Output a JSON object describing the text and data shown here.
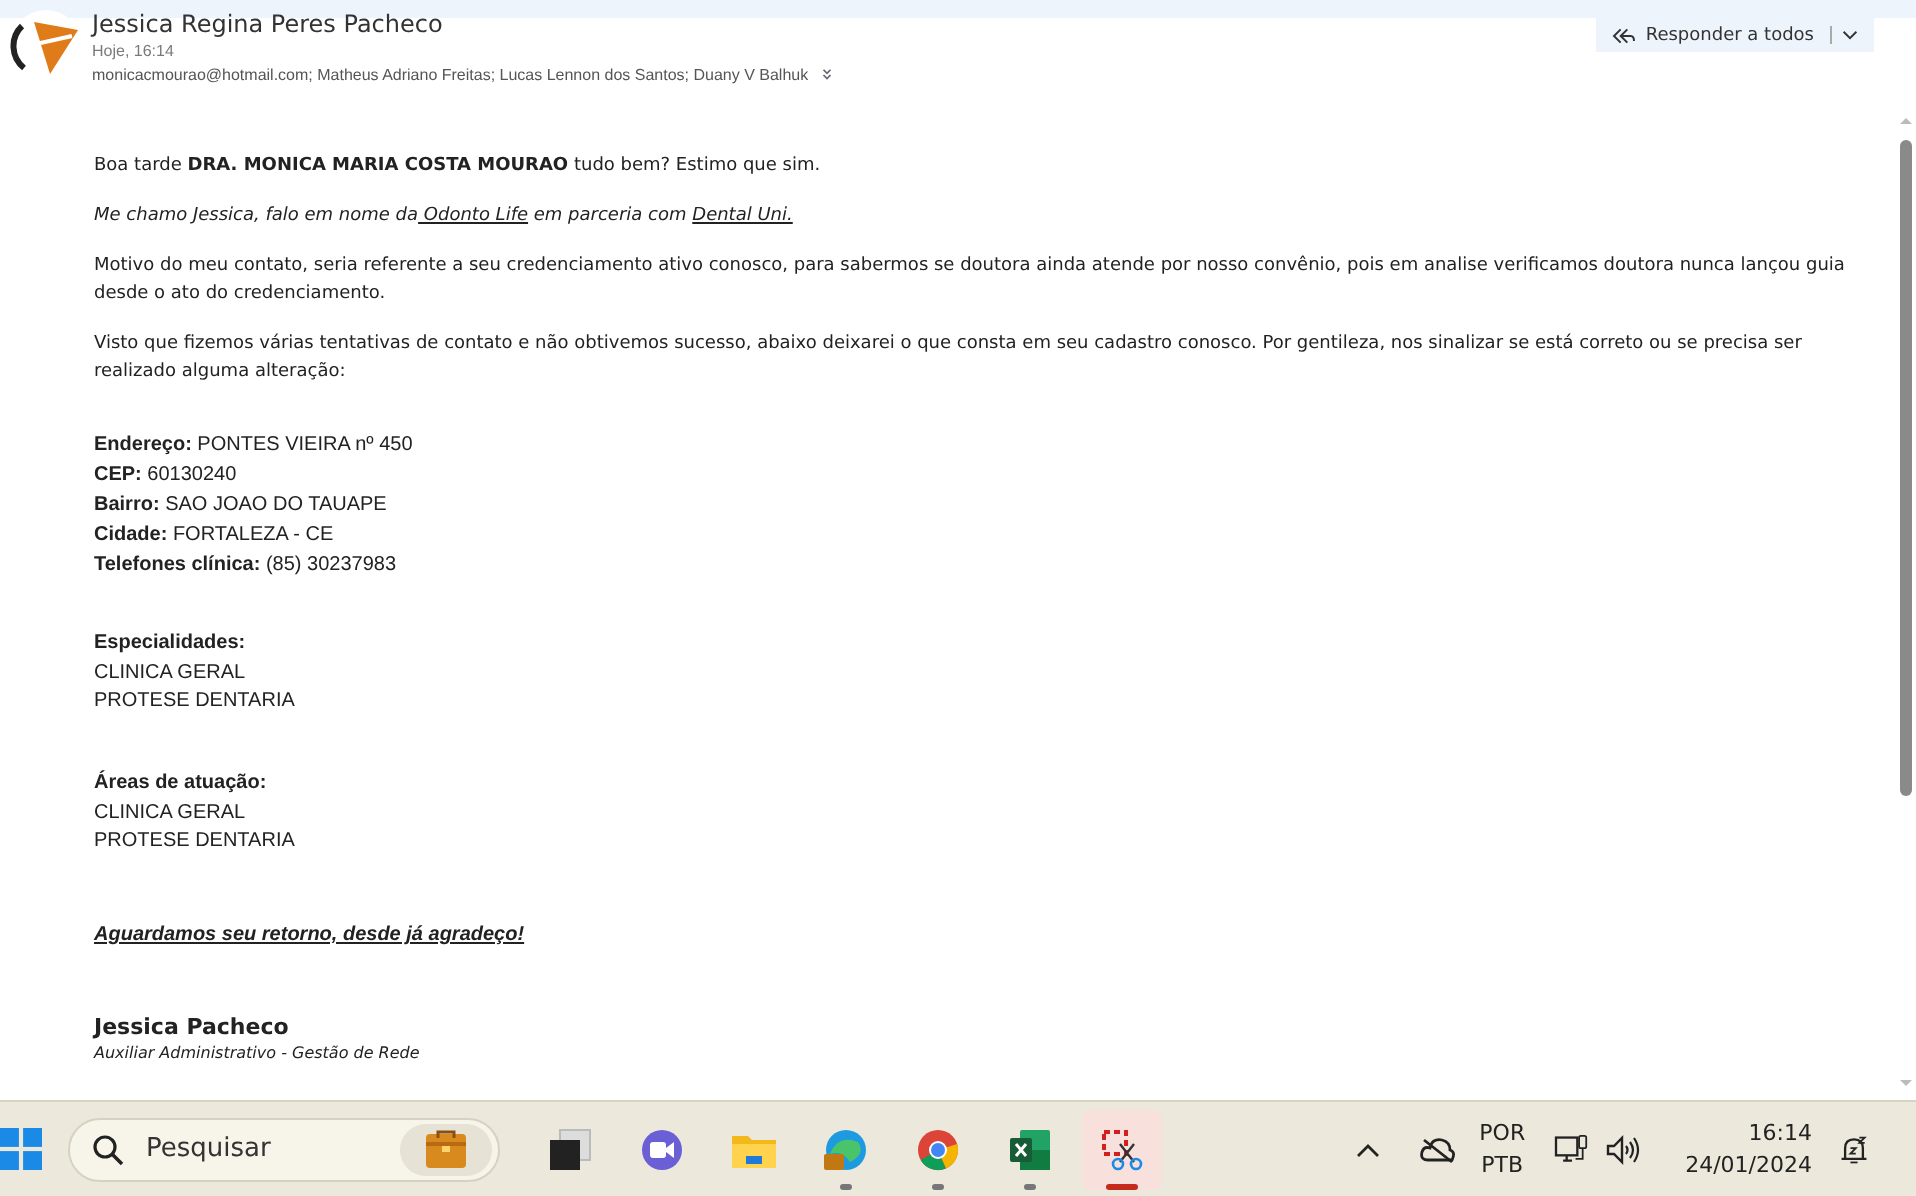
{
  "message": {
    "sender": "Jessica Regina Peres Pacheco",
    "time": "Hoje, 16:14",
    "recipients": "monicacmourao@hotmail.com; Matheus Adriano Freitas; Lucas Lennon dos Santos; Duany V Balhuk",
    "reply_all": "Responder a todos"
  },
  "body": {
    "greeting": "Boa tarde **DRA. MONICA MARIA COSTA MOURAO** tudo bem? Estimo que sim.",
    "intro": {
      "text_before": "Me chamo Jessica, falo em nome da",
      "link_1": "Odonto Life",
      "text_middle": "em parceria com",
      "link_2": "Dental Uni."
    },
    "paragraphs": [
      "Motivo do meu contato, seria referente a seu credenciamento ativo conosco, para sabermos se doutora ainda atende por nosso convênio, pois em analise verificamos doutora nunca lançou guia desde o ato do credenciamento.",
      "Visto que fizemos várias tentativas de contato e não obtivemos sucesso, abaixo deixarei o que consta em seu cadastro conosco. Por gentileza, nos sinalizar se está correto ou se precisa ser realizado alguma alteração:"
    ],
    "fields": [
      "**Endereço:** PONTES VIEIRA nº 450",
      "**CEP:** 60130240",
      "**Bairro:** SAO JOAO DO TAUAPE",
      "**Cidade:** FORTALEZA - CE",
      "**Telefones clínica:** (85) 30237983"
    ],
    "sections": [
      {
        "title": "Especialidades:",
        "items": [
          "CLINICA GERAL",
          "PROTESE DENTARIA"
        ]
      },
      {
        "title": "Áreas de atuação:",
        "items": [
          "CLINICA GERAL",
          "PROTESE DENTARIA"
        ]
      }
    ],
    "closing": "Aguardamos seu retorno, desde já agradeço!",
    "signature": {
      "name": "Jessica Pacheco",
      "role": "Auxiliar Administrativo - Gestão de Rede"
    }
  },
  "taskbar": {
    "search_placeholder": "Pesquisar",
    "apps": [
      {
        "kind": "taskview",
        "running": false,
        "selected": false
      },
      {
        "kind": "meet",
        "running": false,
        "selected": false
      },
      {
        "kind": "folder",
        "running": false,
        "selected": false
      },
      {
        "kind": "edge",
        "running": true,
        "selected": false
      },
      {
        "kind": "chrome",
        "running": true,
        "selected": false
      },
      {
        "kind": "excel",
        "running": true,
        "selected": false
      },
      {
        "kind": "snip",
        "running": true,
        "selected": true
      }
    ],
    "language": "POR",
    "layout": "PTB",
    "time": "16:14",
    "date": "24/01/2024"
  }
}
